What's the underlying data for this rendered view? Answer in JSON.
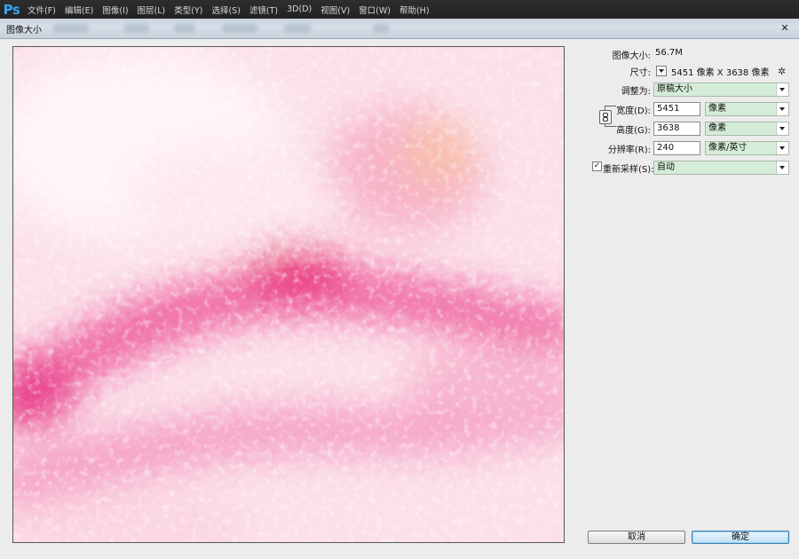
{
  "app": {
    "logo": "Ps",
    "menu": [
      "文件(F)",
      "编辑(E)",
      "图像(I)",
      "图层(L)",
      "类型(Y)",
      "选择(S)",
      "滤镜(T)",
      "3D(D)",
      "视图(V)",
      "窗口(W)",
      "帮助(H)"
    ]
  },
  "dialog": {
    "title": "图像大小",
    "close_symbol": "✕",
    "gear_symbol": "✲",
    "image_size_label": "图像大小:",
    "image_size_value": "56.7M",
    "dimensions_label": "尺寸:",
    "dimensions_value": "5451 像素  X  3638 像素",
    "fit_to_label": "调整为:",
    "fit_to_value": "原稿大小",
    "width_label": "宽度(D):",
    "width_value": "5451",
    "width_unit": "像素",
    "height_label": "高度(G):",
    "height_value": "3638",
    "height_unit": "像素",
    "resolution_label": "分辨率(R):",
    "resolution_value": "240",
    "resolution_unit": "像素/英寸",
    "resample_label": "重新采样(S):",
    "resample_checked": true,
    "resample_check_symbol": "✓",
    "resample_value": "自动",
    "cancel_label": "取消",
    "ok_label": "确定"
  },
  "colors": {
    "accent_blue": "#35a6f4",
    "select_green": "#d5edd8",
    "preview_pink": "#f06ba5",
    "preview_light": "#fde4ee"
  }
}
